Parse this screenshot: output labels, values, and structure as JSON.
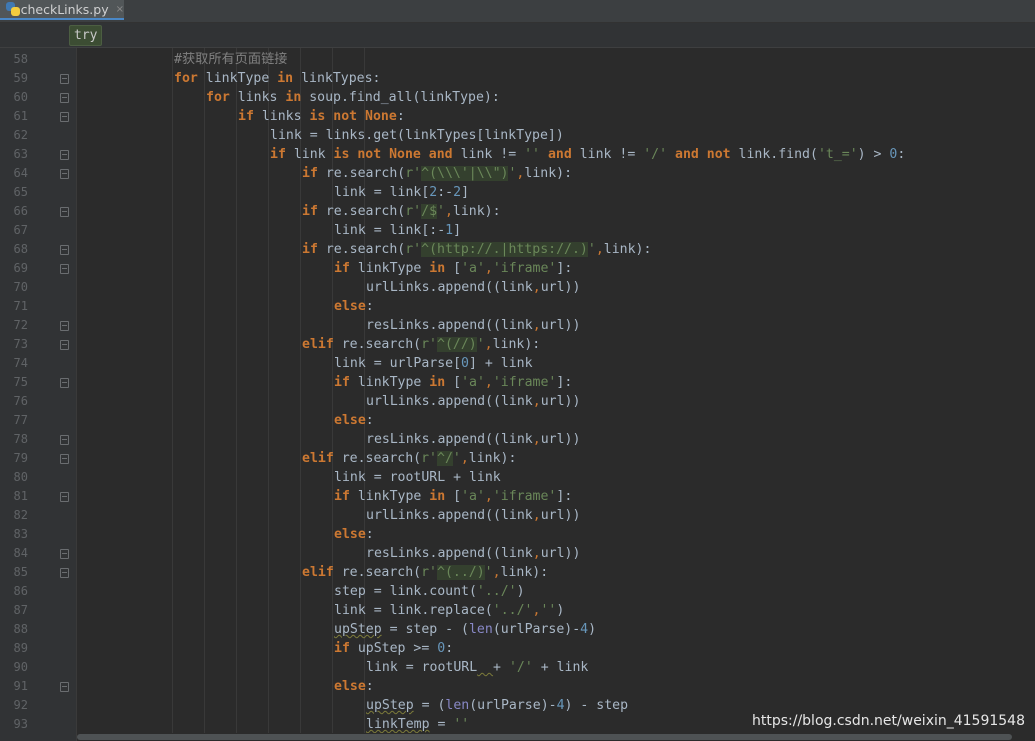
{
  "tab": {
    "filename": "checkLinks.py",
    "close": "×"
  },
  "breadcrumb": {
    "label": "try"
  },
  "watermark": "https://blog.csdn.net/weixin_41591548",
  "colors": {
    "keyword": "#cc7832",
    "string": "#6a8759",
    "number": "#6897bb",
    "comment": "#808080",
    "builtin": "#8888c6",
    "text": "#a9b7c6"
  },
  "editor": {
    "lines": [
      {
        "n": "58",
        "indent": 3,
        "fold": false,
        "tokens": [
          [
            "com",
            "#获取所有页面链接"
          ]
        ]
      },
      {
        "n": "59",
        "indent": 3,
        "fold": true,
        "tokens": [
          [
            "kw",
            "for"
          ],
          [
            "t",
            " linkType "
          ],
          [
            "kw",
            "in"
          ],
          [
            "t",
            " linkTypes:"
          ]
        ]
      },
      {
        "n": "60",
        "indent": 4,
        "fold": true,
        "tokens": [
          [
            "kw",
            "for"
          ],
          [
            "t",
            " links "
          ],
          [
            "kw",
            "in"
          ],
          [
            "t",
            " soup.find_all(linkType):"
          ]
        ]
      },
      {
        "n": "61",
        "indent": 5,
        "fold": true,
        "tokens": [
          [
            "kw",
            "if"
          ],
          [
            "t",
            " links "
          ],
          [
            "kw",
            "is not None"
          ],
          [
            "t",
            ":"
          ]
        ]
      },
      {
        "n": "62",
        "indent": 6,
        "fold": false,
        "tokens": [
          [
            "t",
            "link = links.get(linkTypes[linkType])"
          ]
        ]
      },
      {
        "n": "63",
        "indent": 6,
        "fold": true,
        "tokens": [
          [
            "kw",
            "if"
          ],
          [
            "t",
            " link "
          ],
          [
            "kw",
            "is not None and"
          ],
          [
            "t",
            " link != "
          ],
          [
            "str",
            "''"
          ],
          [
            "t",
            " "
          ],
          [
            "kw",
            "and"
          ],
          [
            "t",
            " link != "
          ],
          [
            "str",
            "'/'"
          ],
          [
            "t",
            " "
          ],
          [
            "kw",
            "and not"
          ],
          [
            "t",
            " link.find("
          ],
          [
            "str",
            "'t_='"
          ],
          [
            "t",
            ") > "
          ],
          [
            "num",
            "0"
          ],
          [
            "t",
            ":"
          ]
        ]
      },
      {
        "n": "64",
        "indent": 7,
        "fold": true,
        "tokens": [
          [
            "kw",
            "if"
          ],
          [
            "t",
            " re.search("
          ],
          [
            "str",
            "r'"
          ],
          [
            "rx",
            "^(\\\\\\'|\\\\\")"
          ],
          [
            "str",
            "'"
          ],
          [
            "cm",
            ","
          ],
          [
            "t",
            "link):"
          ]
        ]
      },
      {
        "n": "65",
        "indent": 8,
        "fold": false,
        "tokens": [
          [
            "t",
            "link = link["
          ],
          [
            "num",
            "2"
          ],
          [
            "t",
            ":-"
          ],
          [
            "num",
            "2"
          ],
          [
            "t",
            "]"
          ]
        ]
      },
      {
        "n": "66",
        "indent": 7,
        "fold": true,
        "tokens": [
          [
            "kw",
            "if"
          ],
          [
            "t",
            " re.search("
          ],
          [
            "str",
            "r'"
          ],
          [
            "rx",
            "/$"
          ],
          [
            "str",
            "'"
          ],
          [
            "cm",
            ","
          ],
          [
            "t",
            "link):"
          ]
        ]
      },
      {
        "n": "67",
        "indent": 8,
        "fold": false,
        "tokens": [
          [
            "t",
            "link = link[:-"
          ],
          [
            "num",
            "1"
          ],
          [
            "t",
            "]"
          ]
        ]
      },
      {
        "n": "68",
        "indent": 7,
        "fold": true,
        "tokens": [
          [
            "kw",
            "if"
          ],
          [
            "t",
            " re.search("
          ],
          [
            "str",
            "r'"
          ],
          [
            "rx",
            "^(http://.|https://.)"
          ],
          [
            "str",
            "'"
          ],
          [
            "cm",
            ","
          ],
          [
            "t",
            "link):"
          ]
        ]
      },
      {
        "n": "69",
        "indent": 8,
        "fold": true,
        "tokens": [
          [
            "kw",
            "if"
          ],
          [
            "t",
            " linkType "
          ],
          [
            "kw",
            "in"
          ],
          [
            "t",
            " ["
          ],
          [
            "str",
            "'a'"
          ],
          [
            "cm",
            ","
          ],
          [
            "str",
            "'iframe'"
          ],
          [
            "t",
            "]:"
          ]
        ]
      },
      {
        "n": "70",
        "indent": 9,
        "fold": false,
        "tokens": [
          [
            "t",
            "urlLinks.append((link"
          ],
          [
            "cm",
            ","
          ],
          [
            "t",
            "url))"
          ]
        ]
      },
      {
        "n": "71",
        "indent": 8,
        "fold": false,
        "tokens": [
          [
            "kw",
            "else"
          ],
          [
            "t",
            ":"
          ]
        ]
      },
      {
        "n": "72",
        "indent": 9,
        "fold": true,
        "tokens": [
          [
            "t",
            "resLinks.append((link"
          ],
          [
            "cm",
            ","
          ],
          [
            "t",
            "url))"
          ]
        ]
      },
      {
        "n": "73",
        "indent": 7,
        "fold": true,
        "tokens": [
          [
            "kw",
            "elif"
          ],
          [
            "t",
            " re.search("
          ],
          [
            "str",
            "r'"
          ],
          [
            "rx",
            "^(//)"
          ],
          [
            "str",
            "'"
          ],
          [
            "cm",
            ","
          ],
          [
            "t",
            "link):"
          ]
        ]
      },
      {
        "n": "74",
        "indent": 8,
        "fold": false,
        "tokens": [
          [
            "t",
            "link = urlParse["
          ],
          [
            "num",
            "0"
          ],
          [
            "t",
            "] + link"
          ]
        ]
      },
      {
        "n": "75",
        "indent": 8,
        "fold": true,
        "tokens": [
          [
            "kw",
            "if"
          ],
          [
            "t",
            " linkType "
          ],
          [
            "kw",
            "in"
          ],
          [
            "t",
            " ["
          ],
          [
            "str",
            "'a'"
          ],
          [
            "cm",
            ","
          ],
          [
            "str",
            "'iframe'"
          ],
          [
            "t",
            "]:"
          ]
        ]
      },
      {
        "n": "76",
        "indent": 9,
        "fold": false,
        "tokens": [
          [
            "t",
            "urlLinks.append((link"
          ],
          [
            "cm",
            ","
          ],
          [
            "t",
            "url))"
          ]
        ]
      },
      {
        "n": "77",
        "indent": 8,
        "fold": false,
        "tokens": [
          [
            "kw",
            "else"
          ],
          [
            "t",
            ":"
          ]
        ]
      },
      {
        "n": "78",
        "indent": 9,
        "fold": true,
        "tokens": [
          [
            "t",
            "resLinks.append((link"
          ],
          [
            "cm",
            ","
          ],
          [
            "t",
            "url))"
          ]
        ]
      },
      {
        "n": "79",
        "indent": 7,
        "fold": true,
        "tokens": [
          [
            "kw",
            "elif"
          ],
          [
            "t",
            " re.search("
          ],
          [
            "str",
            "r'"
          ],
          [
            "rx",
            "^/"
          ],
          [
            "str",
            "'"
          ],
          [
            "cm",
            ","
          ],
          [
            "t",
            "link):"
          ]
        ]
      },
      {
        "n": "80",
        "indent": 8,
        "fold": false,
        "tokens": [
          [
            "t",
            "link = rootURL + link"
          ]
        ]
      },
      {
        "n": "81",
        "indent": 8,
        "fold": true,
        "tokens": [
          [
            "kw",
            "if"
          ],
          [
            "t",
            " linkType "
          ],
          [
            "kw",
            "in"
          ],
          [
            "t",
            " ["
          ],
          [
            "str",
            "'a'"
          ],
          [
            "cm",
            ","
          ],
          [
            "str",
            "'iframe'"
          ],
          [
            "t",
            "]:"
          ]
        ]
      },
      {
        "n": "82",
        "indent": 9,
        "fold": false,
        "tokens": [
          [
            "t",
            "urlLinks.append((link"
          ],
          [
            "cm",
            ","
          ],
          [
            "t",
            "url))"
          ]
        ]
      },
      {
        "n": "83",
        "indent": 8,
        "fold": false,
        "tokens": [
          [
            "kw",
            "else"
          ],
          [
            "t",
            ":"
          ]
        ]
      },
      {
        "n": "84",
        "indent": 9,
        "fold": true,
        "tokens": [
          [
            "t",
            "resLinks.append((link"
          ],
          [
            "cm",
            ","
          ],
          [
            "t",
            "url))"
          ]
        ]
      },
      {
        "n": "85",
        "indent": 7,
        "fold": true,
        "tokens": [
          [
            "kw",
            "elif"
          ],
          [
            "t",
            " re.search("
          ],
          [
            "str",
            "r'"
          ],
          [
            "rx",
            "^(../)"
          ],
          [
            "str",
            "'"
          ],
          [
            "cm",
            ","
          ],
          [
            "t",
            "link):"
          ]
        ]
      },
      {
        "n": "86",
        "indent": 8,
        "fold": false,
        "tokens": [
          [
            "t",
            "step = link.count("
          ],
          [
            "str",
            "'../'"
          ],
          [
            "t",
            ")"
          ]
        ]
      },
      {
        "n": "87",
        "indent": 8,
        "fold": false,
        "tokens": [
          [
            "t",
            "link = link.replace("
          ],
          [
            "str",
            "'../'"
          ],
          [
            "cm",
            ","
          ],
          [
            "str",
            "''"
          ],
          [
            "t",
            ")"
          ]
        ]
      },
      {
        "n": "88",
        "indent": 8,
        "fold": false,
        "tokens": [
          [
            "warn",
            "upStep"
          ],
          [
            "t",
            " = step - ("
          ],
          [
            "bi",
            "len"
          ],
          [
            "t",
            "(urlParse)-"
          ],
          [
            "num",
            "4"
          ],
          [
            "t",
            ")"
          ]
        ]
      },
      {
        "n": "89",
        "indent": 8,
        "fold": false,
        "tokens": [
          [
            "kw",
            "if"
          ],
          [
            "t",
            " upStep >= "
          ],
          [
            "num",
            "0"
          ],
          [
            "t",
            ":"
          ]
        ]
      },
      {
        "n": "90",
        "indent": 9,
        "fold": false,
        "tokens": [
          [
            "t",
            "link = rootURL"
          ],
          [
            "warn",
            "  "
          ],
          [
            "t",
            "+ "
          ],
          [
            "str",
            "'/'"
          ],
          [
            "t",
            " + link"
          ]
        ]
      },
      {
        "n": "91",
        "indent": 8,
        "fold": true,
        "tokens": [
          [
            "kw",
            "else"
          ],
          [
            "t",
            ":"
          ]
        ]
      },
      {
        "n": "92",
        "indent": 9,
        "fold": false,
        "tokens": [
          [
            "warn",
            "upStep"
          ],
          [
            "t",
            " = ("
          ],
          [
            "bi",
            "len"
          ],
          [
            "t",
            "(urlParse)-"
          ],
          [
            "num",
            "4"
          ],
          [
            "t",
            ") - step"
          ]
        ]
      },
      {
        "n": "93",
        "indent": 9,
        "fold": false,
        "tokens": [
          [
            "warn",
            "linkTemp"
          ],
          [
            "t",
            " = "
          ],
          [
            "str",
            "''"
          ]
        ]
      }
    ]
  }
}
